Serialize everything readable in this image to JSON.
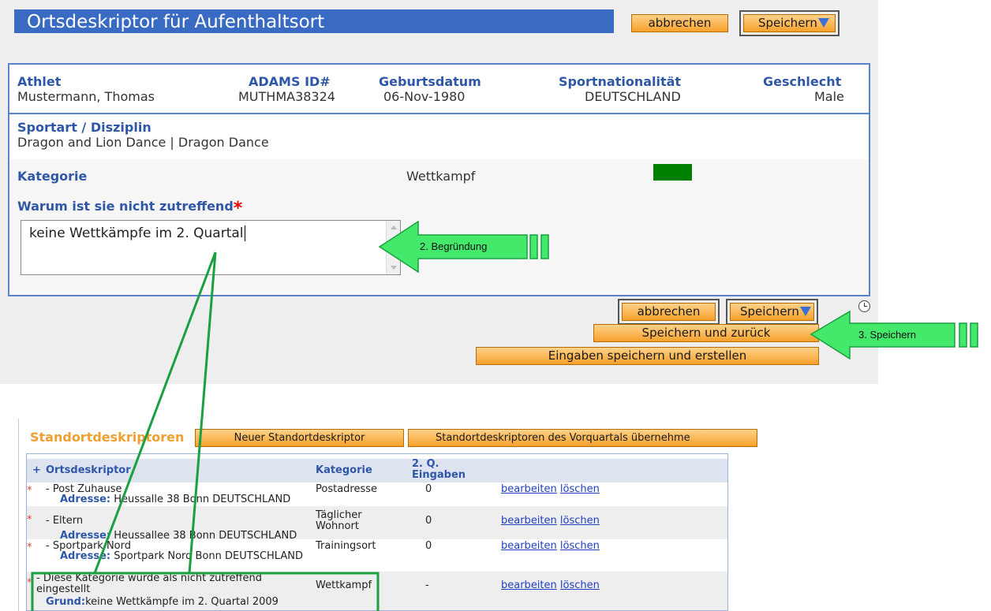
{
  "form": {
    "title": "Ortsdeskriptor für Aufenthaltsort",
    "cancel_label": "abbrechen",
    "save_label": "Speichern",
    "athlete": {
      "name_label": "Athlet",
      "name": "Mustermann, Thomas",
      "id_label": "ADAMS ID#",
      "id": "MUTHMA38324",
      "dob_label": "Geburtsdatum",
      "dob": "06-Nov-1980",
      "nationality_label": "Sportnationalität",
      "nationality": "DEUTSCHLAND",
      "gender_label": "Geschlecht",
      "gender": "Male",
      "sport_label": "Sportart / Disziplin",
      "sport": "Dragon and Lion Dance | Dragon Dance"
    },
    "category_label": "Kategorie",
    "category_value": "Wettkampf",
    "category_color": "#008000",
    "reason_label": "Warum ist sie nicht zutreffend",
    "required_mark": "*",
    "reason_value": "keine Wettkämpfe im 2. Quartal",
    "save_back_label": "Speichern und zurück",
    "save_create_label": "Eingaben speichern und erstellen",
    "clock_icon": "clock-icon"
  },
  "annotations": {
    "step2": "2. Begründung",
    "step3": "3. Speichern",
    "arrow_color": "#33dd55",
    "box_color": "#1aa040"
  },
  "list": {
    "title": "Standortdeskriptoren",
    "new_button": "Neuer Standortdeskriptor",
    "prev_button": "Standortdeskriptoren des Vorquartals übernehme",
    "columns": {
      "plus": "+",
      "name": "Ortsdeskriptor",
      "category": "Kategorie",
      "q_entries_1": "2. Q.",
      "q_entries_2": "Eingaben"
    },
    "rows": [
      {
        "mark": "*",
        "name": "- Post Zuhause",
        "category": "Postadresse",
        "count": "0",
        "addr_label": "Adresse:",
        "addr": "Heussalle 38 Bonn DEUTSCHLAND",
        "edit": "bearbeiten",
        "del": "löschen"
      },
      {
        "mark": "*",
        "name": "- Eltern",
        "category": "Täglicher Wohnort",
        "count": "0",
        "addr_label": "Adresse:",
        "addr": "Heussallee 38 Bonn DEUTSCHLAND",
        "edit": "bearbeiten",
        "del": "löschen"
      },
      {
        "mark": "*",
        "name": "- Sportpark Nord",
        "category": "Trainingsort",
        "count": "0",
        "addr_label": "Adresse:",
        "addr": "Sportpark Nord Bonn DEUTSCHLAND",
        "edit": "bearbeiten",
        "del": "löschen"
      },
      {
        "mark": "*",
        "name": "- Diese Kategorie wurde als nicht zutreffend eingestellt",
        "category": "Wettkampf",
        "count": "-",
        "addr_label": "Grund:",
        "addr": "keine Wettkämpfe im 2. Quartal 2009",
        "edit": "bearbeiten",
        "del": "löschen"
      }
    ]
  }
}
